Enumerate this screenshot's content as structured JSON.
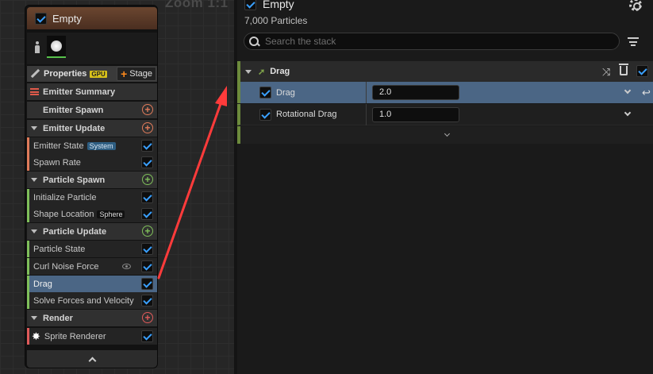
{
  "graph": {
    "zoom_label": "Zoom 1:1"
  },
  "node": {
    "title": "Empty",
    "properties_label": "Properties",
    "gpu_badge": "GPU",
    "stage_label": "Stage",
    "rows": [
      {
        "kind": "summary",
        "label": "Emitter Summary"
      },
      {
        "kind": "header",
        "label": "Emitter Spawn",
        "collapsible": false,
        "accent": "#e07b5a"
      },
      {
        "kind": "header",
        "label": "Emitter Update",
        "collapsible": true,
        "accent": "#e07b5a"
      },
      {
        "kind": "item",
        "label": "Emitter State",
        "badge": "System",
        "accent": "#e07b5a"
      },
      {
        "kind": "item",
        "label": "Spawn Rate",
        "accent": "#e07b5a"
      },
      {
        "kind": "header",
        "label": "Particle Spawn",
        "collapsible": true,
        "accent": "#7fbf5a"
      },
      {
        "kind": "item",
        "label": "Initialize Particle",
        "accent": "#7fbf5a"
      },
      {
        "kind": "item",
        "label": "Shape Location",
        "badge": "Sphere",
        "accent": "#7fbf5a"
      },
      {
        "kind": "header",
        "label": "Particle Update",
        "collapsible": true,
        "accent": "#7fbf5a"
      },
      {
        "kind": "item",
        "label": "Particle State",
        "accent": "#7fbf5a"
      },
      {
        "kind": "item",
        "label": "Curl Noise Force",
        "accent": "#7fbf5a",
        "eye": true
      },
      {
        "kind": "item",
        "label": "Drag",
        "accent": "#7fbf5a",
        "selected": true
      },
      {
        "kind": "item",
        "label": "Solve Forces and Velocity",
        "accent": "#7fbf5a"
      },
      {
        "kind": "header",
        "label": "Render",
        "collapsible": true,
        "accent": "#e05a5a"
      },
      {
        "kind": "sprite",
        "label": "Sprite Renderer",
        "accent": "#e05a5a"
      }
    ]
  },
  "panel": {
    "title": "Empty",
    "particle_count": "7,000 Particles",
    "search_placeholder": "Search the stack",
    "module": {
      "title": "Drag",
      "params": [
        {
          "label": "Drag",
          "value": "2.0",
          "selected": true
        },
        {
          "label": "Rotational Drag",
          "value": "1.0",
          "selected": false
        }
      ]
    }
  },
  "colors": {
    "accent_blue": "#3aa0ff",
    "selection": "#4b6685",
    "arrow": "#ff3b3b",
    "module_bar": "#6c8a3c"
  }
}
